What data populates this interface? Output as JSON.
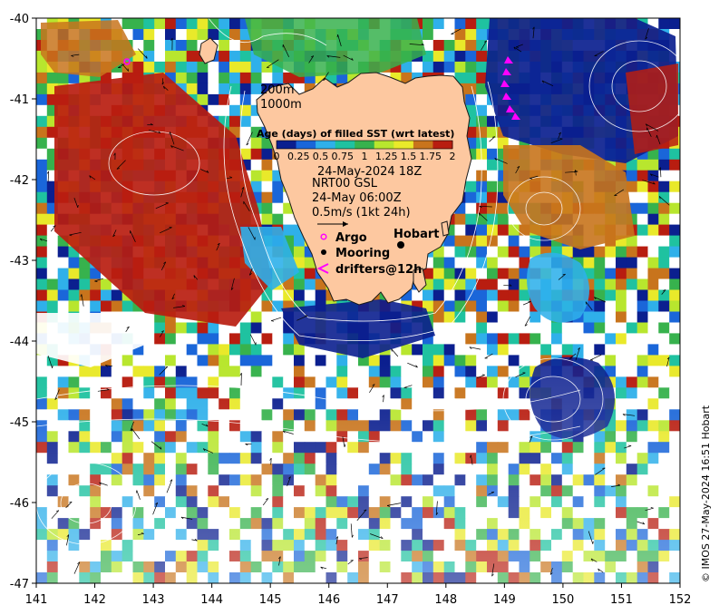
{
  "map": {
    "lon_range": [
      141,
      152
    ],
    "lat_range": [
      -47,
      -40
    ],
    "x_ticks": [
      "141",
      "142",
      "143",
      "144",
      "145",
      "146",
      "147",
      "148",
      "149",
      "150",
      "151",
      "152"
    ],
    "y_ticks": [
      "-40",
      "-41",
      "-42",
      "-43",
      "-44",
      "-45",
      "-46",
      "-47"
    ]
  },
  "legend": {
    "isobaths": [
      "200m",
      "1000m"
    ],
    "colorbar_title": "Age (days) of filled SST (wrt latest)",
    "colorbar_ticks": [
      "0",
      "0.25",
      "0.5",
      "0.75",
      "1",
      "1.25",
      "1.5",
      "1.75",
      "2"
    ],
    "colorbar_colors": [
      "#0b1f8f",
      "#1a66d9",
      "#2fb0ea",
      "#1fc2a0",
      "#37b24d",
      "#b8e62e",
      "#e9e92a",
      "#c8741c",
      "#b81d10"
    ],
    "date_label": "24-May-2024 18Z",
    "model_label": "NRT00 GSL",
    "model_time": "24-May 06:00Z",
    "scale_label": "0.5m/s (1kt 24h)",
    "symbols": {
      "argo": "Argo",
      "mooring": "Mooring",
      "drifters": "drifters@12h"
    },
    "city": "Hobart"
  },
  "colors": {
    "land": "#fdc8a0",
    "coast": "#1a1a1a",
    "argo": "#ff00ff",
    "drifter": "#ff00ff"
  },
  "credit": "© IMOS 27-May-2024 16:51 Hobart"
}
